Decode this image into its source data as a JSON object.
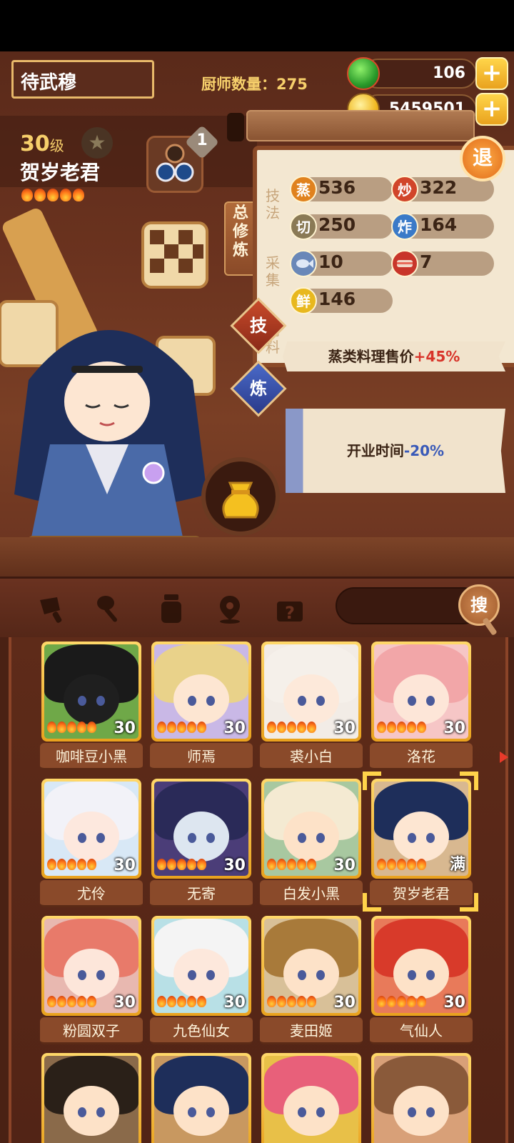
{
  "header": {
    "player_name": "待武穆",
    "chef_count_label": "厨师数量：",
    "chef_count_value": "275",
    "jade_value": "106",
    "coin_value": "5459501",
    "plus_label": "+"
  },
  "chef": {
    "level_num": "30",
    "level_unit": "级",
    "name": "贺岁老君",
    "stars": 5,
    "badge_count": "1"
  },
  "side_tab": {
    "label": "总修炼"
  },
  "exit_button": {
    "label": "退"
  },
  "stats": {
    "categories": {
      "skill": "技法",
      "gather": "采集",
      "season": "调料"
    },
    "items": [
      {
        "icon": "蒸",
        "value": "536",
        "color": "#e0821e"
      },
      {
        "icon": "炒",
        "value": "322",
        "color": "#d1452a"
      },
      {
        "icon": "切",
        "value": "250",
        "color": "#8a7a55"
      },
      {
        "icon": "炸",
        "value": "164",
        "color": "#3a7ac8"
      },
      {
        "icon": "fish",
        "value": "10",
        "color": "#6a88b8"
      },
      {
        "icon": "meat",
        "value": "7",
        "color": "#c8352a"
      },
      {
        "icon": "鲜",
        "value": "146",
        "color": "#e8b81e"
      }
    ]
  },
  "buttons": {
    "skill": "技",
    "refine": "炼"
  },
  "ribbons": {
    "skill_text_main": "蒸类料理售价",
    "skill_text_bonus": "+45%",
    "refine_text_main": "开业时间",
    "refine_text_bonus": "-20%"
  },
  "toolbar": {
    "search_label": "搜"
  },
  "colors": {
    "bonus_red": "#d8342a",
    "bonus_blue": "#3a5ab8",
    "gold": "#f6cf6b"
  },
  "chefs": [
    {
      "name": "咖啡豆小黑",
      "level": "30",
      "bg": "#6fa848",
      "hair": "#1a1a1a",
      "skin": "#1f1f1f"
    },
    {
      "name": "师焉",
      "level": "30",
      "bg": "#c9b8e6",
      "hair": "#e9d28a",
      "skin": "#fde6d2"
    },
    {
      "name": "裘小白",
      "level": "30",
      "bg": "#f2ece6",
      "hair": "#f5f0ea",
      "skin": "#fde9da"
    },
    {
      "name": "洛花",
      "level": "30",
      "bg": "#f6c6c6",
      "hair": "#f2a6a8",
      "skin": "#fde6d8"
    },
    {
      "name": "尤伶",
      "level": "30",
      "bg": "#d8e8f6",
      "hair": "#f2f2f8",
      "skin": "#fde8de"
    },
    {
      "name": "无寄",
      "level": "30",
      "bg": "#4b3d78",
      "hair": "#2a2a58",
      "skin": "#dde6f0"
    },
    {
      "name": "白发小黑",
      "level": "30",
      "bg": "#a8c8a0",
      "hair": "#f4ead2",
      "skin": "#fde2c8"
    },
    {
      "name": "贺岁老君",
      "level": "满",
      "bg": "#d8b890",
      "hair": "#1e2e5a",
      "skin": "#fde6d2"
    },
    {
      "name": "粉圆双子",
      "level": "30",
      "bg": "#e8b8b0",
      "hair": "#e87a6a",
      "skin": "#fde6da"
    },
    {
      "name": "九色仙女",
      "level": "30",
      "bg": "#b8e0e6",
      "hair": "#f4f4f4",
      "skin": "#fde8dc"
    },
    {
      "name": "麦田姬",
      "level": "30",
      "bg": "#d8c098",
      "hair": "#a87a3a",
      "skin": "#fde2c8"
    },
    {
      "name": "气仙人",
      "level": "30",
      "bg": "#e87a5a",
      "hair": "#d83a2a",
      "skin": "#fde2c8"
    },
    {
      "name": "",
      "level": "",
      "bg": "#8a6a4a",
      "hair": "#2a2018",
      "skin": "#fde2c8"
    },
    {
      "name": "",
      "level": "",
      "bg": "#c89860",
      "hair": "#1e2e5a",
      "skin": "#fde2c8"
    },
    {
      "name": "",
      "level": "",
      "bg": "#e8c048",
      "hair": "#e8607a",
      "skin": "#fde2c8"
    },
    {
      "name": "",
      "level": "",
      "bg": "#d8a078",
      "hair": "#8a5a3a",
      "skin": "#fde2c8"
    }
  ]
}
